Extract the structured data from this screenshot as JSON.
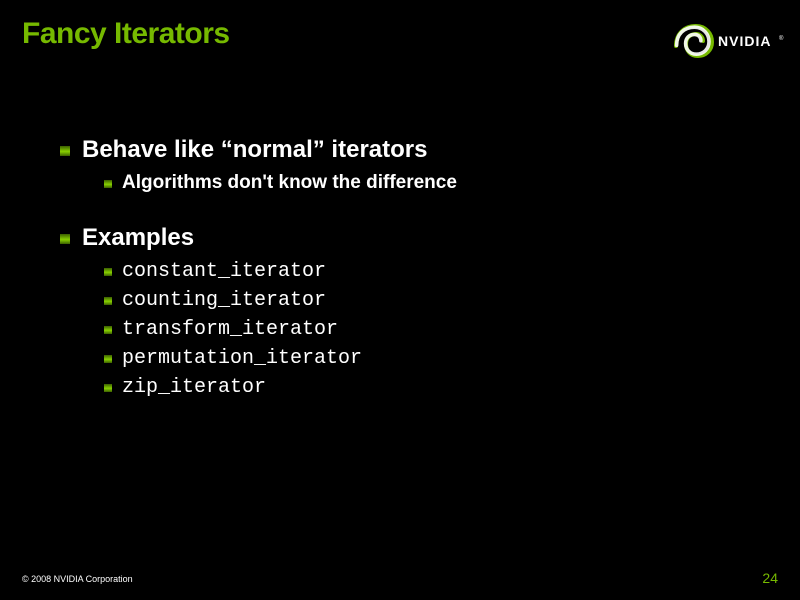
{
  "title": "Fancy Iterators",
  "brand": {
    "name": "NVIDIA",
    "accent": "#76b900"
  },
  "bullets": {
    "lvl1": {
      "b1": "Behave like “normal” iterators",
      "b2": "Examples"
    },
    "sub1": {
      "s1": "Algorithms don't know the difference"
    },
    "sub2": {
      "s1": "constant_iterator",
      "s2": "counting_iterator",
      "s3": "transform_iterator",
      "s4": "permutation_iterator",
      "s5": "zip_iterator"
    }
  },
  "footer": {
    "copyright": "© 2008 NVIDIA Corporation",
    "page": "24"
  }
}
